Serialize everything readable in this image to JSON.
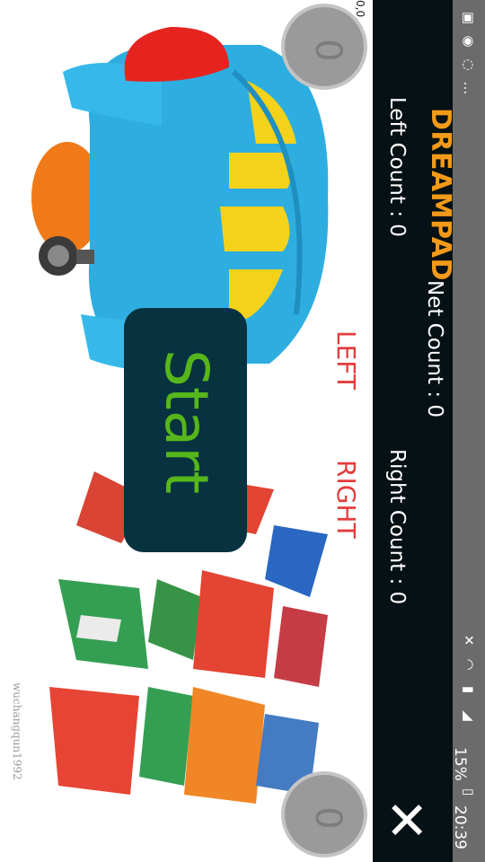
{
  "status_bar": {
    "time": "20:39",
    "battery": "15%",
    "icons": [
      "gallery-icon",
      "messenger-icon",
      "whatsapp-icon",
      "more-icon",
      "mute-icon",
      "wifi-icon",
      "sim-icon",
      "signal-icon",
      "battery-icon"
    ]
  },
  "app": {
    "title": "DREAMPAD",
    "close_label": "✕"
  },
  "counts": {
    "net": "Net Count : 0",
    "left": "Left Count : 0",
    "right": "Right Count : 0"
  },
  "labels": {
    "left": "LEFT",
    "right": "RIGHT"
  },
  "joysticks": {
    "top_value": "0,0",
    "top_knob": "0",
    "bottom_knob": "0"
  },
  "start_button": {
    "label": "Start"
  },
  "watermark": "wuchangqun1992",
  "colors": {
    "title": "#f39a1a",
    "header_bg": "#061115",
    "start_bg": "#073240",
    "start_text": "#57b61b",
    "direction_labels": "#e43c3c",
    "plane_body": "#2eaee0",
    "plane_nose": "#e52420",
    "plane_windows": "#f5d21a"
  }
}
